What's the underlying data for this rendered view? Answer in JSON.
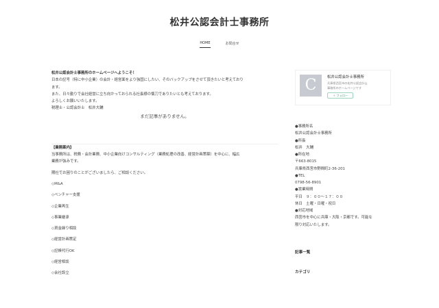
{
  "site": {
    "title": "松井公認会計士事務所"
  },
  "nav": {
    "home": "HOME",
    "contact": "お問合せ"
  },
  "main": {
    "intro_title": "松井公認会計士事務所のホームページへようこそ！",
    "intro_lines": [
      "日本の記号（特に中小企業）の会計・経営面をより強固にしたい、そのバックアップをさせて頂きたいと考えており",
      "ます。",
      "また、日々勤りで会社経営に立ち向かっておられる社長様の懐刀でありたいとも考えております。",
      "よろしくお願いいたします。",
      "税理士・公認会計士　松井大輔"
    ],
    "no_posts": "まだ記事がありません。",
    "service_title": "【業務案内】",
    "service_lines": [
      "当事務所は、税務・会計業務、中小企業向けコンサルティング（業務処理の改善、経営計画策築）を中心に、幅広",
      "業務が強みです。",
      "期社でお困りのことがございましたら、ご相談ください。"
    ],
    "services": [
      "◇M&A",
      "◇ベンチャー支援",
      "◇企業再生",
      "◇事業継承",
      "◇資金繰り相談",
      "◇経営計画策定",
      "◇記帳代行OK",
      "◇経営相談",
      "◇会社設立"
    ]
  },
  "sidebar": {
    "profile": {
      "avatar_letter": "C",
      "name": "松井公認会計士事務所",
      "desc_1": "兵庫県西宮市の松井公認会計士",
      "desc_2": "事務所のホームページです",
      "follow": "＋ フォロー"
    },
    "info": [
      "●事務所名",
      "松井公認会計士事務所",
      "●所長",
      "松井　大輔",
      "●所在地",
      "〒663-8015",
      "兵庫県西宮市野間町2-36-201",
      "●TEL",
      "0798-56-8901",
      "●営業時間",
      "平日　９：００～１７：００",
      "休日　土曜・日曜・祝日",
      "●対応地域",
      "西宮市を中心に兵庫・大阪・京都です。可能な",
      "限り対応いたします。"
    ],
    "widget_posts": "記事一覧",
    "widget_categories": "カテゴリ"
  }
}
